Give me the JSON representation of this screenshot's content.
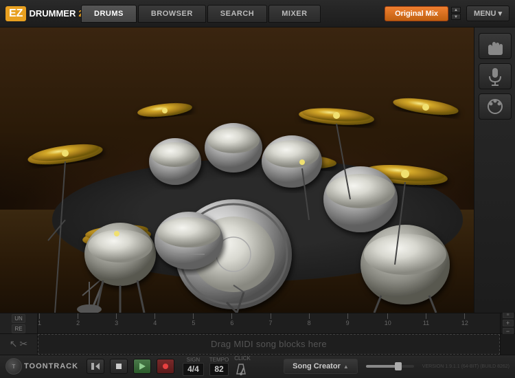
{
  "app": {
    "logo_ez": "EZ",
    "logo_drummer": "DRUMMER",
    "logo_version": "2"
  },
  "nav": {
    "tabs": [
      {
        "id": "drums",
        "label": "DRUMS",
        "active": true
      },
      {
        "id": "browser",
        "label": "bRoWSER",
        "active": false
      },
      {
        "id": "search",
        "label": "SEARCH",
        "active": false
      },
      {
        "id": "mixer",
        "label": "MIXER",
        "active": false
      }
    ],
    "mix_label": "Original Mix",
    "menu_label": "MENU ▾"
  },
  "right_controls": {
    "btn1_icon": "🤚",
    "btn2_icon": "🎙",
    "btn3_icon": "🔔"
  },
  "timeline": {
    "undo_label": "UN",
    "redo_label": "RE",
    "marks": [
      1,
      2,
      3,
      4,
      5,
      6,
      7,
      8,
      9,
      10,
      11,
      12
    ],
    "scroll_up": "▲",
    "scroll_down": "▼",
    "zoom_in": "+",
    "zoom_out": "-"
  },
  "midi_zone": {
    "drag_text": "Drag MIDI song blocks here"
  },
  "transport": {
    "toontrack_label": "TOONTRACK",
    "rewind_icon": "↺",
    "stop_icon": "■",
    "play_icon": "▶",
    "sign_label": "SIGN",
    "sign_value": "4/4",
    "tempo_label": "TEMPO",
    "tempo_value": "82",
    "click_label": "CLICK",
    "song_creator_label": "Song Creator",
    "song_creator_arrow": "▲",
    "version_text": "VERSION 1.9.1.1 (64-BIT) (BUILD 8262)"
  }
}
